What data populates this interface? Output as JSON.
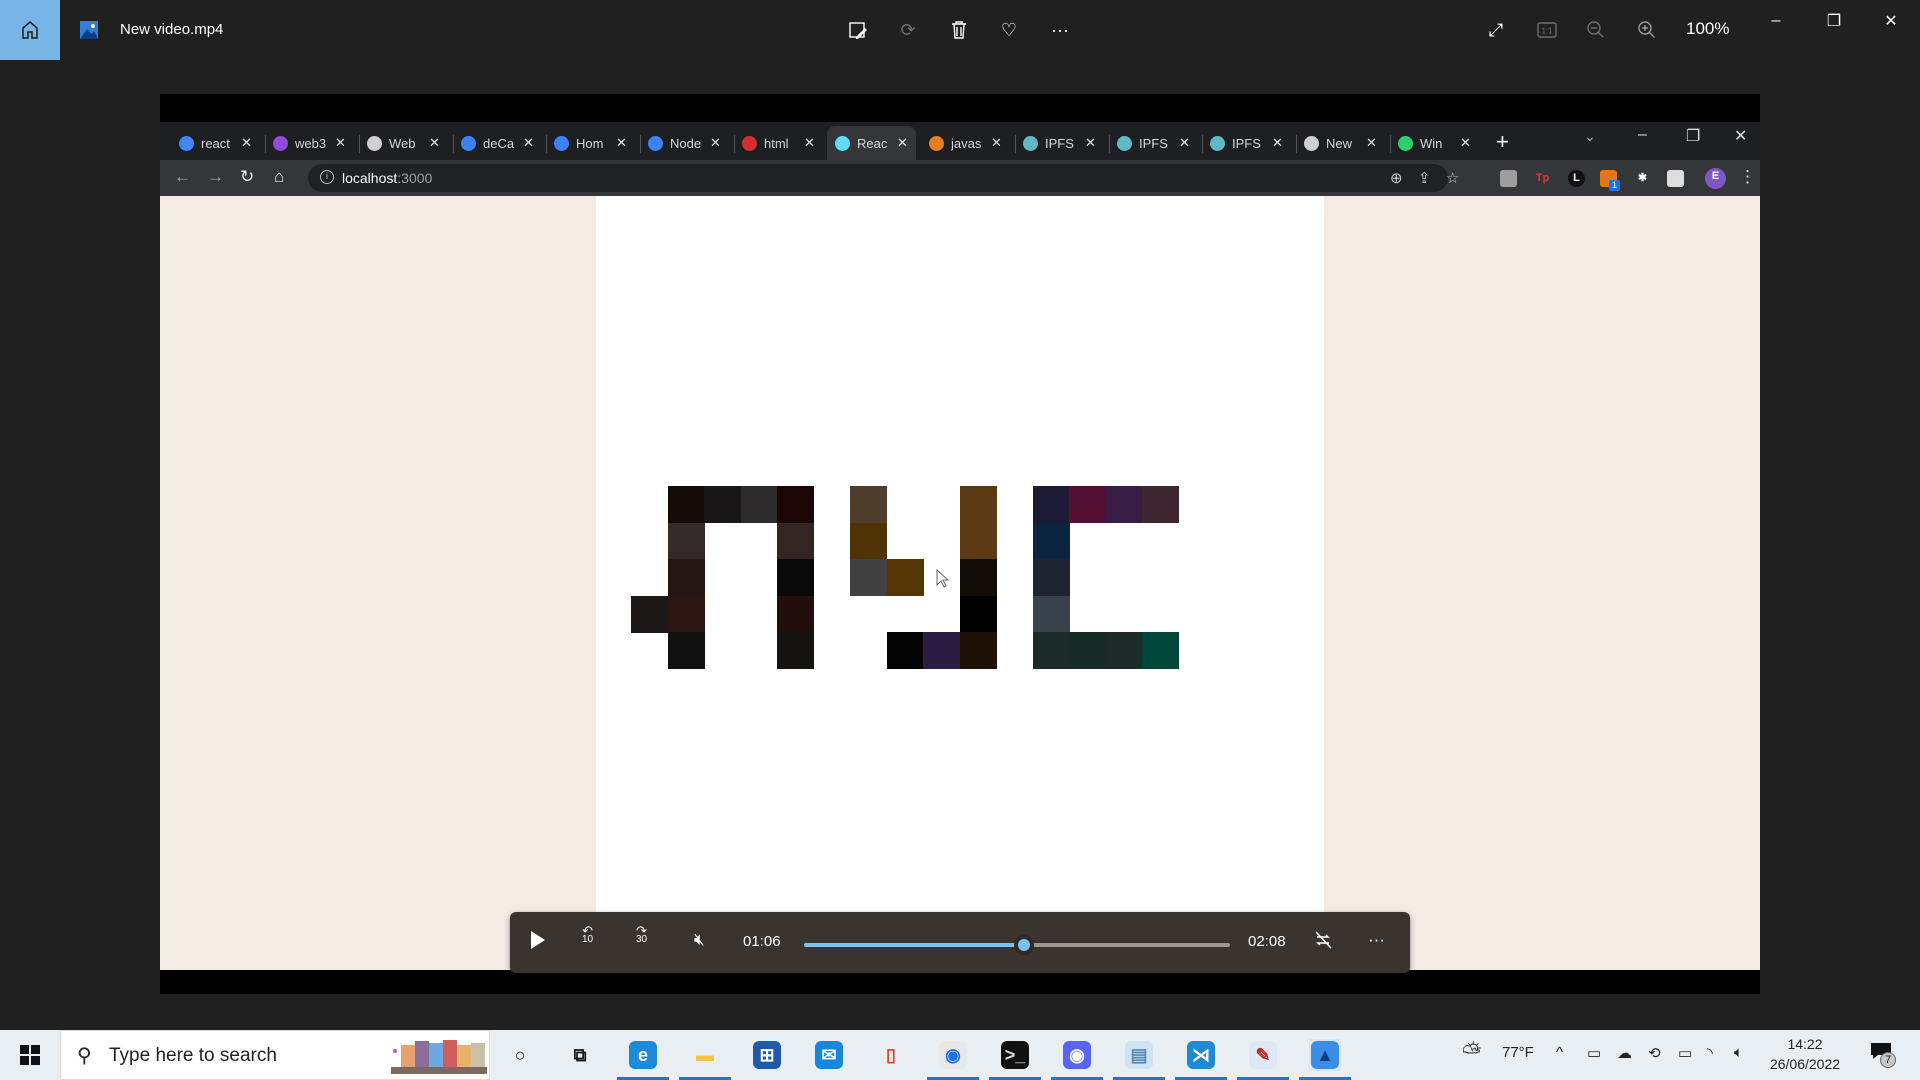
{
  "app": {
    "title": "New video.mp4",
    "zoom_level": "100%",
    "toolbar_icons": [
      "edit-image-icon",
      "rotate-icon",
      "delete-icon",
      "favorite-icon",
      "more-icon"
    ],
    "view_icons": [
      "fullscreen-icon",
      "actual-size-icon",
      "zoom-out-icon",
      "zoom-in-icon"
    ]
  },
  "browser": {
    "tabs": [
      {
        "label": "react",
        "favicon": "google-icon",
        "color": "#4285f4"
      },
      {
        "label": "web3",
        "favicon": "web3-icon",
        "color": "#8f4ad9"
      },
      {
        "label": "Web",
        "favicon": "web-icon",
        "color": "#cfcfcf"
      },
      {
        "label": "deCa",
        "favicon": "wave-icon",
        "color": "#3b82f6"
      },
      {
        "label": "Hom",
        "favicon": "wave-icon",
        "color": "#3b82f6"
      },
      {
        "label": "Node",
        "favicon": "wave-icon",
        "color": "#3b82f6"
      },
      {
        "label": "html",
        "favicon": "n-icon",
        "color": "#d32f2f"
      },
      {
        "label": "Reac",
        "favicon": "react-icon",
        "color": "#61dafb",
        "active": true
      },
      {
        "label": "javas",
        "favicon": "java-icon",
        "color": "#e67e22"
      },
      {
        "label": "IPFS",
        "favicon": "ipfs-icon",
        "color": "#5fb9c6"
      },
      {
        "label": "IPFS",
        "favicon": "ipfs-icon",
        "color": "#5fb9c6"
      },
      {
        "label": "IPFS",
        "favicon": "ipfs-icon",
        "color": "#5fb9c6"
      },
      {
        "label": "New",
        "favicon": "chrome-icon",
        "color": "#cfcfcf"
      },
      {
        "label": "Win",
        "favicon": "w-icon",
        "color": "#2ecc71"
      }
    ],
    "close_glyph": "✕",
    "new_tab_glyph": "+",
    "url_host": "localhost",
    "url_port": ":3000",
    "extensions": [
      {
        "name": "ext-grey-icon",
        "text": "",
        "color": "#9e9e9e"
      },
      {
        "name": "ext-tp-icon",
        "text": "Tp",
        "color": "#e53935"
      },
      {
        "name": "ext-l-icon",
        "text": "L",
        "color": "#111111"
      },
      {
        "name": "ext-metamask-icon",
        "text": "",
        "color": "#e2761b",
        "badge": "1"
      },
      {
        "name": "ext-puzzle-icon",
        "text": "✱",
        "color": "transparent"
      },
      {
        "name": "ext-sidepanel-icon",
        "text": "",
        "color": "#dddddd"
      }
    ],
    "profile_initial": "E",
    "profile_color": "#7e57c2"
  },
  "pixel_art": {
    "cells": [
      {
        "c": 1,
        "r": 0,
        "color": "#140b09"
      },
      {
        "c": 2,
        "r": 0,
        "color": "#181616"
      },
      {
        "c": 3,
        "r": 0,
        "color": "#2d2b2b"
      },
      {
        "c": 4,
        "r": 0,
        "color": "#1b0505"
      },
      {
        "c": 1,
        "r": 1,
        "color": "#322b2a"
      },
      {
        "c": 4,
        "r": 1,
        "color": "#342524"
      },
      {
        "c": 1,
        "r": 2,
        "color": "#251615"
      },
      {
        "c": 4,
        "r": 2,
        "color": "#0a0909"
      },
      {
        "c": 0,
        "r": 3,
        "color": "#1c1818"
      },
      {
        "c": 1,
        "r": 3,
        "color": "#2a1513"
      },
      {
        "c": 4,
        "r": 3,
        "color": "#220f0d"
      },
      {
        "c": 1,
        "r": 4,
        "color": "#111111"
      },
      {
        "c": 4,
        "r": 4,
        "color": "#151212"
      },
      {
        "c": 6,
        "r": 0,
        "color": "#4f3e2e"
      },
      {
        "c": 9,
        "r": 0,
        "color": "#5c3a14"
      },
      {
        "c": 6,
        "r": 1,
        "color": "#4f3205"
      },
      {
        "c": 9,
        "r": 1,
        "color": "#5c3a14"
      },
      {
        "c": 6,
        "r": 2,
        "color": "#414040"
      },
      {
        "c": 7,
        "r": 2,
        "color": "#553505"
      },
      {
        "c": 9,
        "r": 2,
        "color": "#120c07"
      },
      {
        "c": 9,
        "r": 3,
        "color": "#020101"
      },
      {
        "c": 7,
        "r": 4,
        "color": "#040303"
      },
      {
        "c": 8,
        "r": 4,
        "color": "#291d44"
      },
      {
        "c": 9,
        "r": 4,
        "color": "#1e1005"
      },
      {
        "c": 11,
        "r": 0,
        "color": "#1d1a35"
      },
      {
        "c": 12,
        "r": 0,
        "color": "#520e33"
      },
      {
        "c": 13,
        "r": 0,
        "color": "#391c46"
      },
      {
        "c": 14,
        "r": 0,
        "color": "#3e2631"
      },
      {
        "c": 11,
        "r": 1,
        "color": "#0d2441"
      },
      {
        "c": 11,
        "r": 2,
        "color": "#1e2530"
      },
      {
        "c": 11,
        "r": 3,
        "color": "#3a424b"
      },
      {
        "c": 11,
        "r": 4,
        "color": "#1b2b27"
      },
      {
        "c": 12,
        "r": 4,
        "color": "#192b26"
      },
      {
        "c": 13,
        "r": 4,
        "color": "#1d2b28"
      },
      {
        "c": 14,
        "r": 4,
        "color": "#00473a"
      }
    ]
  },
  "player": {
    "current_time": "01:06",
    "duration": "02:08",
    "progress_fraction": 0.516,
    "muted": true,
    "skip_back_label": "10",
    "skip_forward_label": "30",
    "accent": "#7cc0f0"
  },
  "taskbar": {
    "search_placeholder": "Type here to search",
    "apps": [
      "cortana-icon",
      "task-view-icon",
      "edge-icon",
      "file-explorer-icon",
      "store-icon",
      "mail-icon",
      "office-icon",
      "chrome-icon",
      "terminal-icon",
      "discord-icon",
      "notepad-icon",
      "vscode-icon",
      "paint-icon",
      "photos-icon"
    ],
    "weather": "77°F",
    "time": "14:22",
    "date": "26/06/2022",
    "notification_count": "7"
  }
}
